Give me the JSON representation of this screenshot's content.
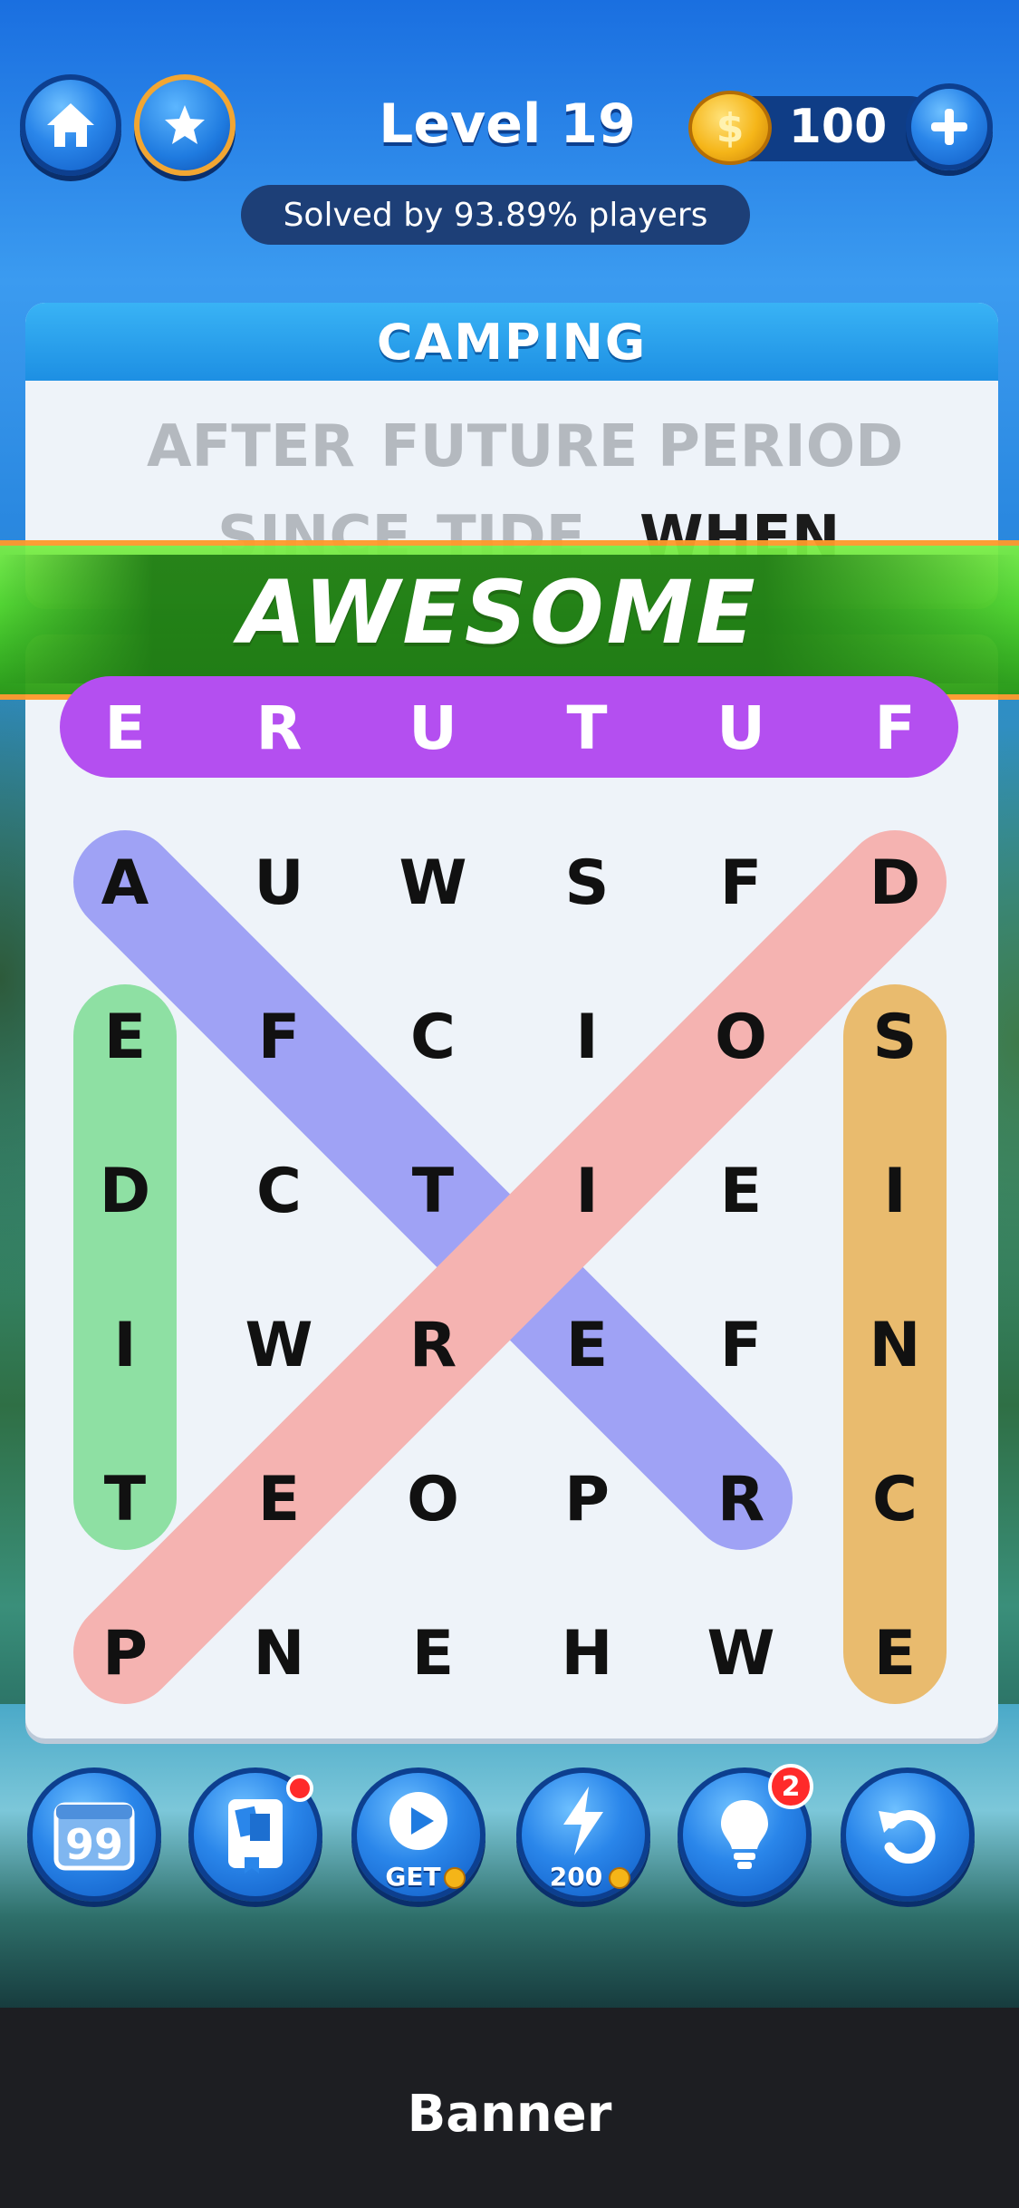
{
  "header": {
    "level_title": "Level 19",
    "coins": "100",
    "coin_symbol": "$",
    "solved_text": "Solved by 93.89% players"
  },
  "category": "CAMPING",
  "words": [
    "AFTER",
    "FUTURE",
    "PERIOD",
    "SINCE",
    "TIDE",
    "WHEN"
  ],
  "popup": "AWESOME",
  "selected_row": [
    "E",
    "R",
    "U",
    "T",
    "U",
    "F"
  ],
  "grid": [
    [
      "A",
      "U",
      "W",
      "S",
      "F",
      "D"
    ],
    [
      "E",
      "F",
      "C",
      "I",
      "O",
      "S"
    ],
    [
      "D",
      "C",
      "T",
      "I",
      "E",
      "I"
    ],
    [
      "I",
      "W",
      "R",
      "E",
      "F",
      "N"
    ],
    [
      "T",
      "E",
      "O",
      "P",
      "R",
      "C"
    ],
    [
      "P",
      "N",
      "E",
      "H",
      "W",
      "E"
    ]
  ],
  "found_words": [
    {
      "word": "AFTER",
      "from": [
        0,
        0
      ],
      "to": [
        4,
        4
      ],
      "color": "#9fa2f5"
    },
    {
      "word": "PERIOD",
      "from": [
        5,
        0
      ],
      "to": [
        0,
        5
      ],
      "color": "#f5b3b1"
    },
    {
      "word": "TIDE",
      "from": [
        1,
        0
      ],
      "to": [
        4,
        0
      ],
      "color": "#8ee0a3"
    },
    {
      "word": "SINCE",
      "from": [
        1,
        5
      ],
      "to": [
        5,
        5
      ],
      "color": "#e9bb6e"
    }
  ],
  "selection_color": "#b44ff0",
  "tools": [
    {
      "name": "quotes",
      "label": ""
    },
    {
      "name": "book",
      "label": ""
    },
    {
      "name": "video",
      "label": "GET"
    },
    {
      "name": "lightning",
      "label": "200"
    },
    {
      "name": "hint",
      "label": "",
      "badge": "2"
    },
    {
      "name": "undo",
      "label": ""
    }
  ],
  "banner": "Banner"
}
